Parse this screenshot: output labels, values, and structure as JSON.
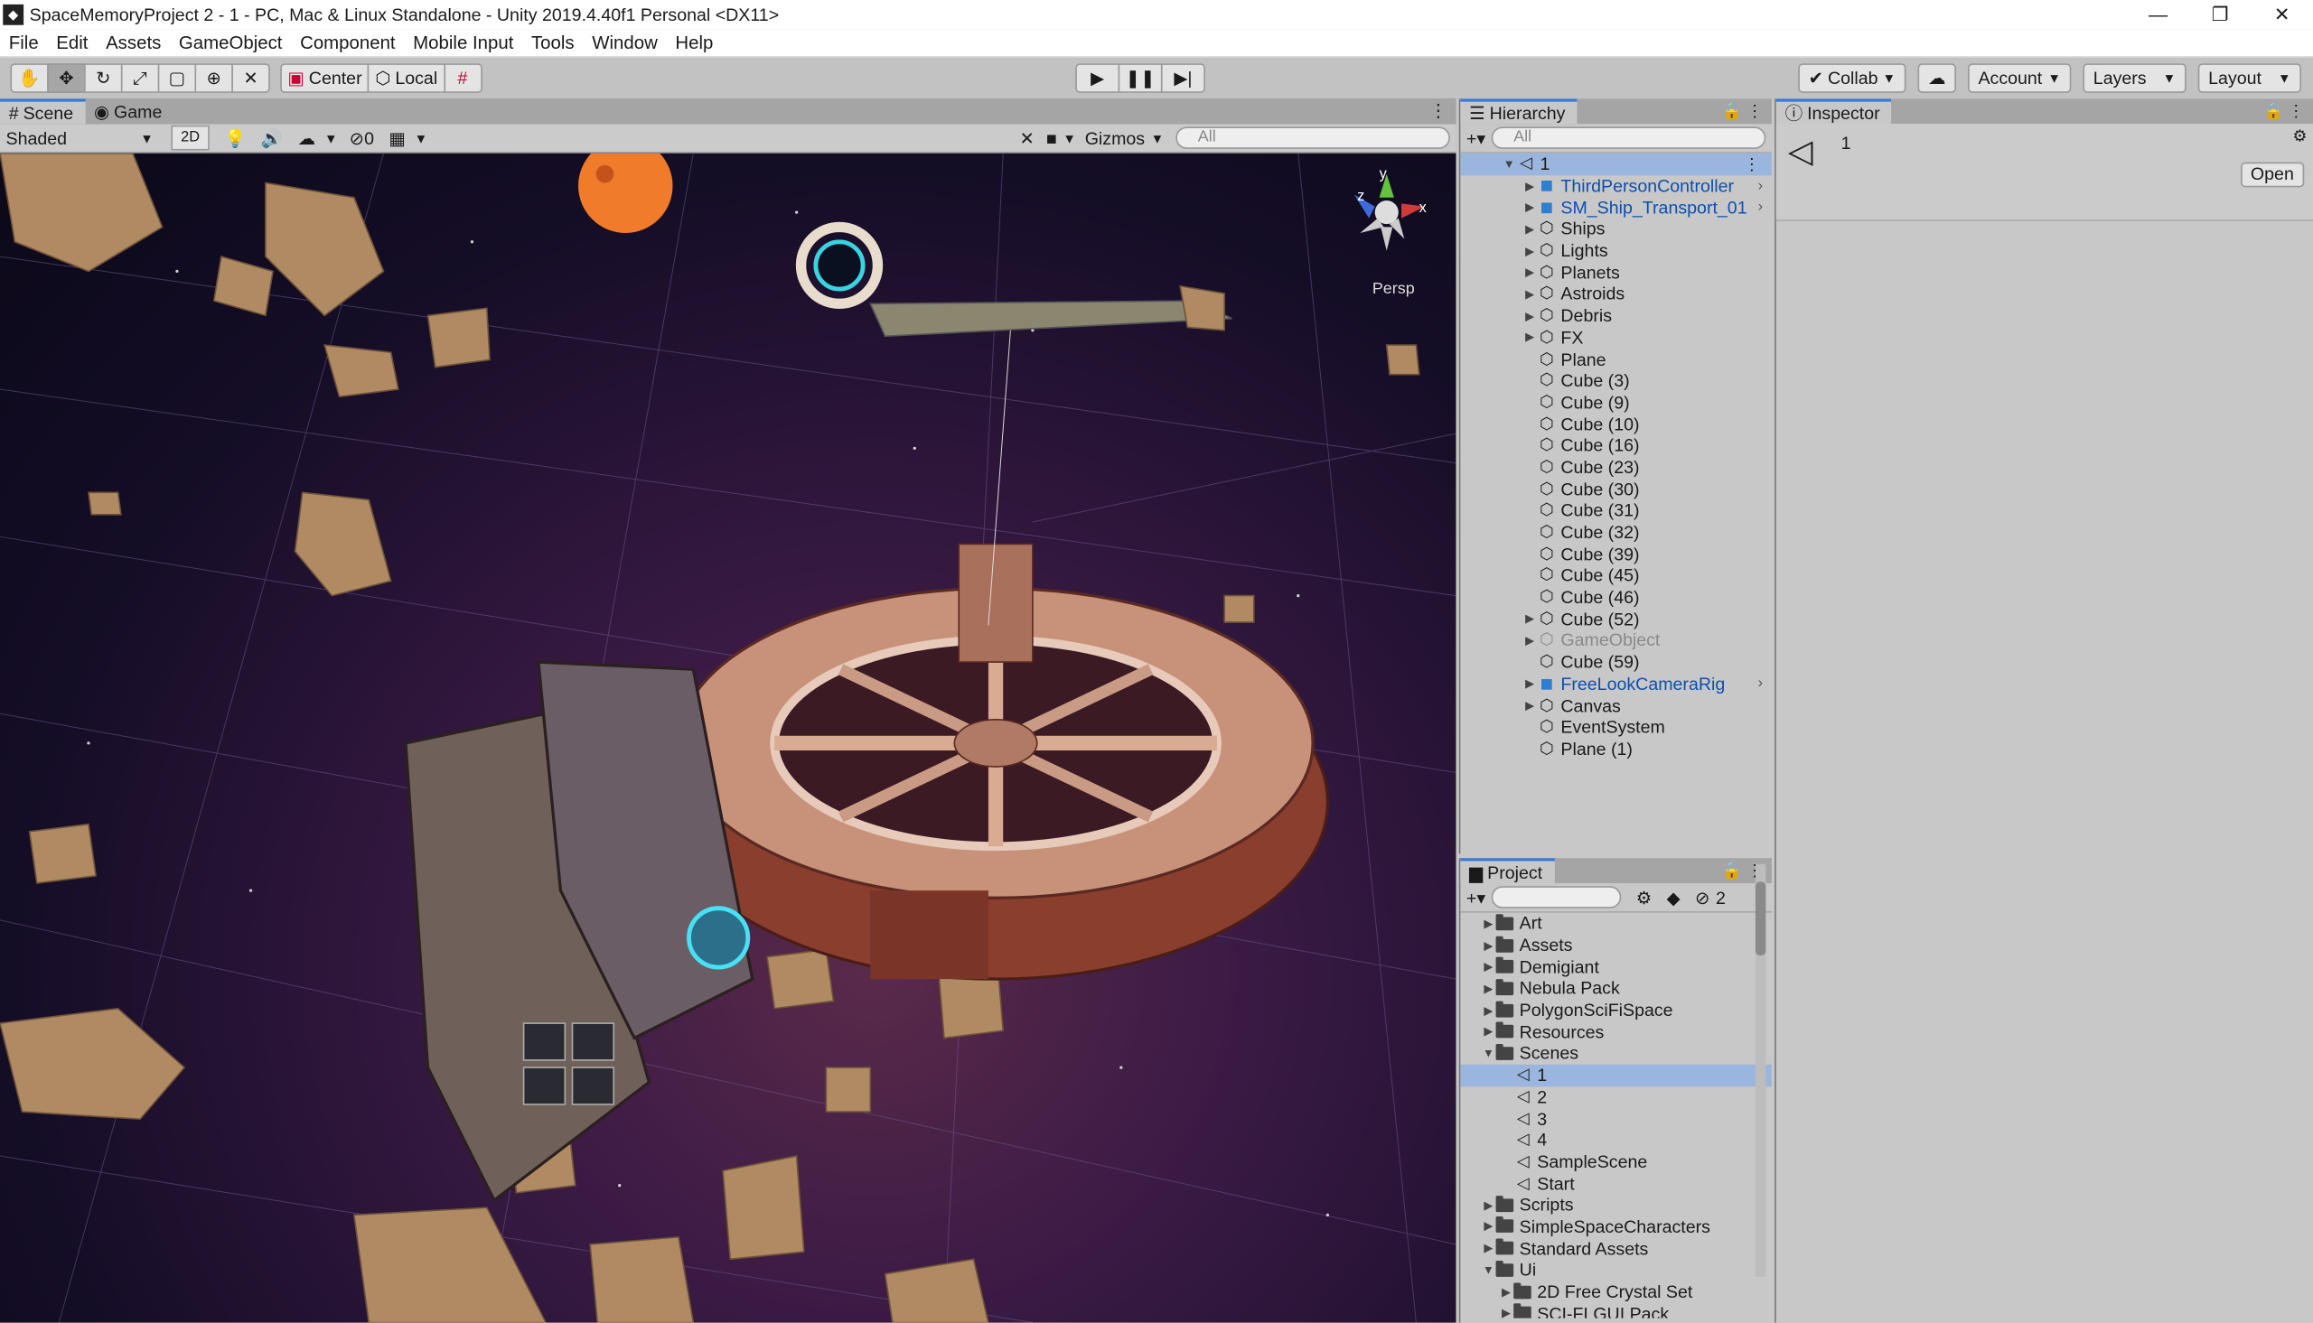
{
  "window": {
    "title": "SpaceMemoryProject 2 - 1 - PC, Mac & Linux Standalone - Unity 2019.4.40f1 Personal <DX11>",
    "controls": [
      "—",
      "❐",
      "✕"
    ]
  },
  "menu": [
    "File",
    "Edit",
    "Assets",
    "GameObject",
    "Component",
    "Mobile Input",
    "Tools",
    "Window",
    "Help"
  ],
  "toolbar": {
    "pivot": "Center",
    "space": "Local",
    "collab": "Collab",
    "account": "Account",
    "layers": "Layers",
    "layout": "Layout"
  },
  "scene": {
    "tabs": [
      "Scene",
      "Game"
    ],
    "shading": "Shaded",
    "mode_2d": "2D",
    "hidden_count": "0",
    "gizmos": "Gizmos",
    "search_placeholder": "All",
    "persp": "Persp",
    "gizmo_axes": [
      "y",
      "z",
      "x"
    ]
  },
  "hierarchy": {
    "title": "Hierarchy",
    "search_placeholder": "All",
    "scene_name": "1",
    "items": [
      {
        "label": "ThirdPersonController",
        "prefab": true,
        "expandable": true
      },
      {
        "label": "SM_Ship_Transport_01",
        "prefab": true,
        "expandable": true
      },
      {
        "label": "Ships",
        "expandable": true
      },
      {
        "label": "Lights",
        "expandable": true
      },
      {
        "label": "Planets",
        "expandable": true
      },
      {
        "label": "Astroids",
        "expandable": true
      },
      {
        "label": "Debris",
        "expandable": true
      },
      {
        "label": "FX",
        "expandable": true
      },
      {
        "label": "Plane"
      },
      {
        "label": "Cube (3)"
      },
      {
        "label": "Cube (9)"
      },
      {
        "label": "Cube (10)"
      },
      {
        "label": "Cube (16)"
      },
      {
        "label": "Cube (23)"
      },
      {
        "label": "Cube (30)"
      },
      {
        "label": "Cube (31)"
      },
      {
        "label": "Cube (32)"
      },
      {
        "label": "Cube (39)"
      },
      {
        "label": "Cube (45)"
      },
      {
        "label": "Cube (46)"
      },
      {
        "label": "Cube (52)",
        "expandable": true
      },
      {
        "label": "GameObject",
        "expandable": true,
        "disabled": true
      },
      {
        "label": "Cube (59)"
      },
      {
        "label": "FreeLookCameraRig",
        "prefab": true,
        "expandable": true
      },
      {
        "label": "Canvas",
        "expandable": true
      },
      {
        "label": "EventSystem"
      },
      {
        "label": "Plane (1)"
      }
    ]
  },
  "project": {
    "title": "Project",
    "hidden_count": "2",
    "items": [
      {
        "label": "Art",
        "type": "folder",
        "level": 0,
        "state": "collapsed"
      },
      {
        "label": "Assets",
        "type": "folder",
        "level": 0,
        "state": "collapsed"
      },
      {
        "label": "Demigiant",
        "type": "folder",
        "level": 0,
        "state": "collapsed"
      },
      {
        "label": "Nebula Pack",
        "type": "folder",
        "level": 0,
        "state": "collapsed"
      },
      {
        "label": "PolygonSciFiSpace",
        "type": "folder",
        "level": 0,
        "state": "collapsed"
      },
      {
        "label": "Resources",
        "type": "folder",
        "level": 0,
        "state": "collapsed"
      },
      {
        "label": "Scenes",
        "type": "folder",
        "level": 0,
        "state": "expanded"
      },
      {
        "label": "1",
        "type": "scene",
        "level": 1,
        "selected": true
      },
      {
        "label": "2",
        "type": "scene",
        "level": 1
      },
      {
        "label": "3",
        "type": "scene",
        "level": 1
      },
      {
        "label": "4",
        "type": "scene",
        "level": 1
      },
      {
        "label": "SampleScene",
        "type": "scene",
        "level": 1
      },
      {
        "label": "Start",
        "type": "scene",
        "level": 1
      },
      {
        "label": "Scripts",
        "type": "folder",
        "level": 0,
        "state": "collapsed"
      },
      {
        "label": "SimpleSpaceCharacters",
        "type": "folder",
        "level": 0,
        "state": "collapsed"
      },
      {
        "label": "Standard Assets",
        "type": "folder",
        "level": 0,
        "state": "collapsed"
      },
      {
        "label": "Ui",
        "type": "folder",
        "level": 0,
        "state": "expanded"
      },
      {
        "label": "2D Free Crystal Set",
        "type": "folder",
        "level": 1,
        "state": "collapsed"
      },
      {
        "label": "SCI-FI GUI Pack",
        "type": "folder",
        "level": 1,
        "state": "collapsed"
      }
    ]
  },
  "inspector": {
    "title": "Inspector",
    "object_name": "1",
    "open_label": "Open"
  },
  "colors": {
    "accent": "#3a79d8",
    "prefab_text": "#0b4fb0",
    "selection": "#9ab6de"
  }
}
